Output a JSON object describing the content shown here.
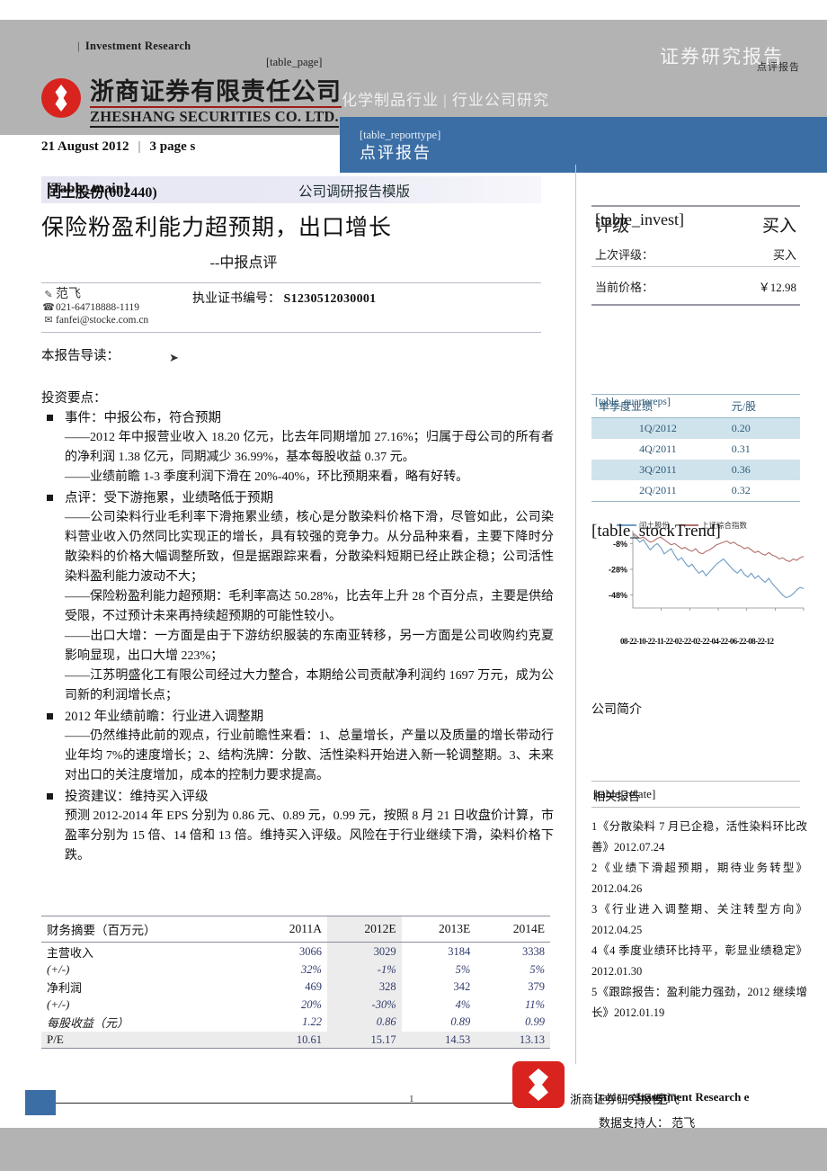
{
  "header": {
    "investment_research": "Investment   Research",
    "divider_glyph": "|",
    "table_page_tag": "[table_page]",
    "securities_research_report": "证券研究报告",
    "report_kind_small": "点评报告",
    "logo_cn": "浙商证券有限责任公司",
    "logo_en": "ZHESHANG SECURITIES CO. LTD.",
    "industry_line": "化学制品行业  |  行业公司研究",
    "reporttype_tag": "[table_reporttype]",
    "reporttype_cn": "点评报告",
    "date": "21 August 2012",
    "pages": "3 page s"
  },
  "title_block": {
    "table_main_tag": "[Table_main]",
    "stock_name_code": "闰土股份(002440)",
    "template_label": "公司调研报告模版",
    "headline": "保险粉盈利能力超预期，出口增长",
    "subheadline": "--中报点评",
    "author": "范飞",
    "phone": "021-64718888-1119",
    "email": "fanfei@stocke.com.cn",
    "cert_label": "执业证书编号：",
    "cert_number": "S1230512030001",
    "pencil_icon": "✎",
    "phone_icon": "☎",
    "mail_icon": "✉",
    "arrow_icon": "➤"
  },
  "body": {
    "guide_label": "本报告导读：",
    "points_label": "投资要点：",
    "points": [
      {
        "head": "事件：中报公布，符合预期",
        "paras": [
          "——2012 年中报营业收入 18.20 亿元，比去年同期增加 27.16%；归属于母公司的所有者的净利润 1.38 亿元，同期减少 36.99%，基本每股收益 0.37 元。",
          "——业绩前瞻 1-3 季度利润下滑在 20%-40%，环比预期来看，略有好转。"
        ]
      },
      {
        "head": "点评：受下游拖累，业绩略低于预期",
        "paras": [
          "——公司染料行业毛利率下滑拖累业绩，核心是分散染料价格下滑，尽管如此，公司染料营业收入仍然同比实现正的增长，具有较强的竞争力。从分品种来看，主要下降时分散染料的价格大幅调整所致，但是据跟踪来看，分散染料短期已经止跌企稳；公司活性染料盈利能力波动不大；",
          "——保险粉盈利能力超预期：毛利率高达 50.28%，比去年上升 28 个百分点，主要是供给受限，不过预计未来再持续超预期的可能性较小。",
          "——出口大增：一方面是由于下游纺织服装的东南亚转移，另一方面是公司收购约克夏影响显现，出口大增 223%；",
          "——江苏明盛化工有限公司经过大力整合，本期给公司贡献净利润约 1697 万元，成为公司新的利润增长点；"
        ]
      },
      {
        "head": "2012 年业绩前瞻：行业进入调整期",
        "paras": [
          "——仍然维持此前的观点，行业前瞻性来看：1、总量增长，产量以及质量的增长带动行业年均 7%的速度增长；2、结构洗牌：分散、活性染料开始进入新一轮调整期。3、未来对出口的关注度增加，成本的控制力要求提高。"
        ]
      },
      {
        "head": "投资建议：维持买入评级",
        "paras": [
          "预测 2012-2014 年 EPS 分别为 0.86 元、0.89 元，0.99 元，按照 8 月 21 日收盘价计算，市盈率分别为 15 倍、14 倍和 13 倍。维持买入评级。风险在于行业继续下滑，染料价格下跌。"
        ]
      }
    ]
  },
  "fin_table": {
    "columns": [
      "财务摘要（百万元）",
      "2011A",
      "2012E",
      "2013E",
      "2014E"
    ],
    "rows": [
      {
        "label": "主营收入",
        "italic": false,
        "values": [
          "3066",
          "3029",
          "3184",
          "3338"
        ]
      },
      {
        "label": "(+/-)",
        "italic": true,
        "values": [
          "32%",
          "-1%",
          "5%",
          "5%"
        ]
      },
      {
        "label": "净利润",
        "italic": false,
        "values": [
          "469",
          "328",
          "342",
          "379"
        ]
      },
      {
        "label": "(+/-)",
        "italic": true,
        "values": [
          "20%",
          "-30%",
          "4%",
          "11%"
        ]
      },
      {
        "label": "每股收益（元）",
        "italic": true,
        "values": [
          "1.22",
          "0.86",
          "0.89",
          "0.99"
        ]
      },
      {
        "label": "P/E",
        "italic": false,
        "values": [
          "10.61",
          "15.17",
          "14.53",
          "13.13"
        ]
      }
    ]
  },
  "sidebar": {
    "invest": {
      "tag": "[table_invest]",
      "rating_label": "评级",
      "rating_value": "买入",
      "prev_label": "上次评级：",
      "prev_value": "买入",
      "price_label": "当前价格：",
      "price_value": "￥12.98"
    },
    "quartereps": {
      "tag": "[table_quartereps]",
      "head_label": "单季度业绩",
      "head_unit": "元/股",
      "rows": [
        {
          "period": "1Q/2012",
          "eps": "0.20"
        },
        {
          "period": "4Q/2011",
          "eps": "0.31"
        },
        {
          "period": "3Q/2011",
          "eps": "0.36"
        },
        {
          "period": "2Q/2011",
          "eps": "0.32"
        }
      ]
    },
    "stock_trend_tag": "[table_stockTrend]",
    "company_brief": "公司简介",
    "relate": {
      "tag": "[table_relate]",
      "label": "相关报告",
      "items": [
        "1《分散染料 7 月已企稳，活性染料环比改善》2012.07.24",
        "2《业绩下滑超预期，期待业务转型》2012.04.26",
        "3《行业进入调整期、关注转型方向》2012.04.25",
        "4《4 季度业绩环比持平，彰显业绩稳定》2012.01.30",
        "5《跟踪报告：盈利能力强劲，2012 继续增长》2012.01.19"
      ]
    }
  },
  "chart_data": {
    "type": "line",
    "title": "",
    "xlabel": "",
    "ylabel": "",
    "ylim": [
      -58,
      2
    ],
    "yticks": [
      -8,
      -28,
      -48
    ],
    "ytick_labels": [
      "-8%",
      "-28%",
      "-48%"
    ],
    "grid": false,
    "legend_position": "top",
    "x_tick_labels": [
      "08-22",
      "10-22",
      "11-22",
      "12-22",
      "02-22",
      "04-22",
      "06-22",
      "08-22",
      "12"
    ],
    "x_labels_joined": "08-22-10-22-11-22-02-22-02-22-04-22-06-22-08-22-12",
    "series": [
      {
        "name": "闰土股份",
        "color": "#6f9cc4",
        "values": [
          -1,
          -4,
          -7,
          -5,
          -9,
          -13,
          -10,
          -8,
          -11,
          -16,
          -14,
          -12,
          -17,
          -21,
          -19,
          -23,
          -26,
          -24,
          -28,
          -31,
          -29,
          -33,
          -30,
          -27,
          -24,
          -22,
          -20,
          -23,
          -26,
          -29,
          -31,
          -28,
          -32,
          -34,
          -31,
          -35,
          -33,
          -36,
          -38,
          -35,
          -39,
          -42,
          -45,
          -48,
          -50,
          -49,
          -47,
          -44,
          -42,
          -43
        ]
      },
      {
        "name": "上证综合指数",
        "color": "#b2716d",
        "values": [
          0,
          -2,
          -4,
          -3,
          -5,
          -7,
          -6,
          -4,
          -3,
          -5,
          -7,
          -9,
          -8,
          -10,
          -12,
          -11,
          -13,
          -14,
          -12,
          -15,
          -16,
          -14,
          -13,
          -11,
          -9,
          -8,
          -7,
          -6,
          -8,
          -7,
          -9,
          -10,
          -12,
          -11,
          -13,
          -15,
          -14,
          -16,
          -17,
          -15,
          -17,
          -18,
          -20,
          -19,
          -21,
          -22,
          -20,
          -21,
          -19,
          -18
        ]
      }
    ]
  },
  "footer": {
    "page_number": "1",
    "company_report": "浙商证券研究报告",
    "research_tag": "[table_research]",
    "author": "范飞",
    "research_en": "Investment  Research  e",
    "data_support_label": "数据支持人：",
    "data_support_name": "范飞"
  }
}
